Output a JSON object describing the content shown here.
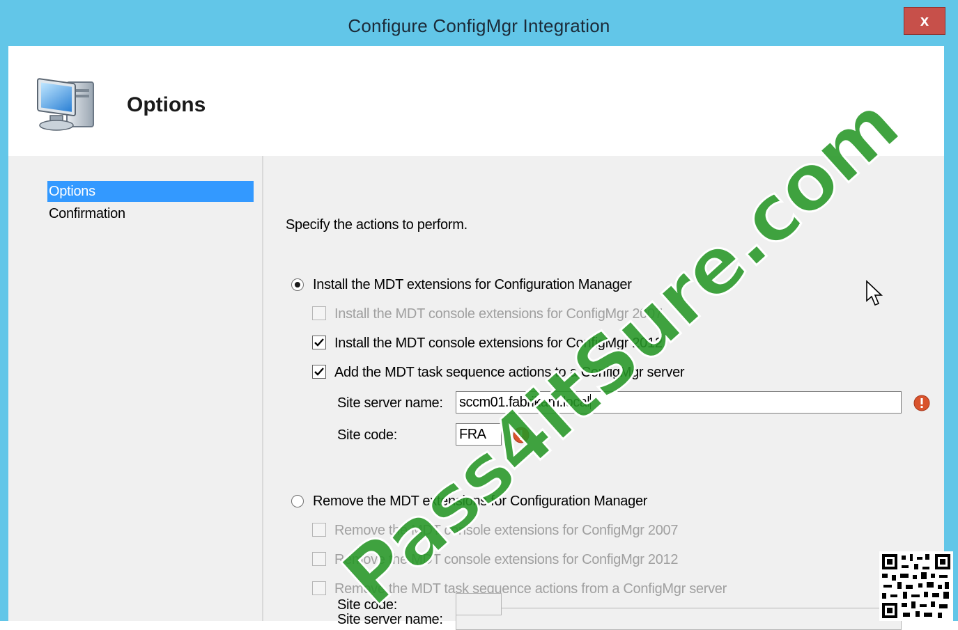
{
  "window": {
    "title": "Configure ConfigMgr Integration",
    "close_label": "x"
  },
  "header": {
    "title": "Options",
    "icon": "computer-icon"
  },
  "sidebar": {
    "items": [
      {
        "label": "Options",
        "active": true
      },
      {
        "label": "Confirmation",
        "active": false
      }
    ]
  },
  "main": {
    "instruction": "Specify the actions to perform.",
    "install": {
      "radio_label": "Install the MDT extensions for Configuration Manager",
      "selected": true,
      "options": [
        {
          "label": "Install the MDT console extensions for ConfigMgr 2007",
          "checked": false,
          "enabled": false
        },
        {
          "label": "Install the MDT console extensions for ConfigMgr 2012",
          "checked": true,
          "enabled": true
        },
        {
          "label": "Add the MDT task sequence actions to a ConfigMgr server",
          "checked": true,
          "enabled": true
        }
      ],
      "site_server_label": "Site server name:",
      "site_server_value": "sccm01.fabrikam.local",
      "site_code_label": "Site code:",
      "site_code_value": "FRA"
    },
    "remove": {
      "radio_label": "Remove the MDT extensions for Configuration Manager",
      "selected": false,
      "options": [
        {
          "label": "Remove the MDT console extensions for ConfigMgr 2007",
          "checked": false,
          "enabled": false
        },
        {
          "label": "Remove the MDT console extensions for ConfigMgr 2012",
          "checked": false,
          "enabled": false
        },
        {
          "label": "Remove the MDT task sequence actions from a ConfigMgr server",
          "checked": false,
          "enabled": false
        }
      ],
      "site_server_label": "Site server name:",
      "site_server_value": "",
      "site_code_label": "Site code:",
      "site_code_value": ""
    }
  },
  "watermark": "Pass4itSure.com",
  "colors": {
    "title_bar": "#62c6e8",
    "close_button": "#c7504a",
    "selection": "#3399ff",
    "panel": "#f0f0f0",
    "watermark": "#269626",
    "error_icon": "#d9532c"
  }
}
